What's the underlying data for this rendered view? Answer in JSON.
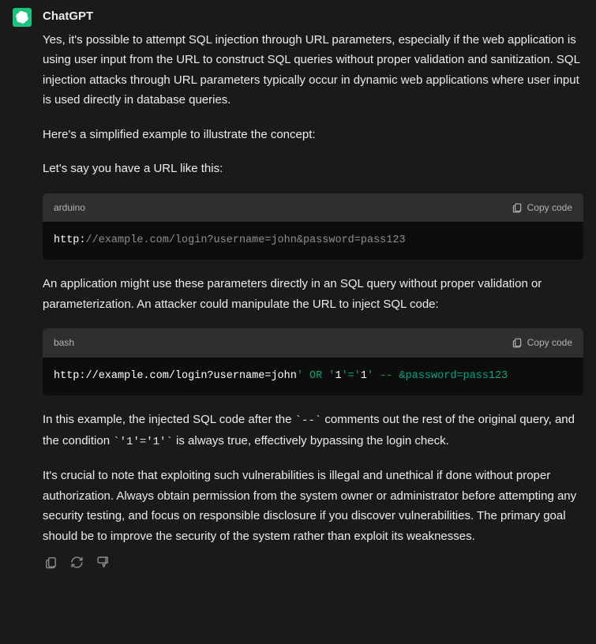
{
  "author": "ChatGPT",
  "paragraphs": {
    "p1": "Yes, it's possible to attempt SQL injection through URL parameters, especially if the web application is using user input from the URL to construct SQL queries without proper validation and sanitization. SQL injection attacks through URL parameters typically occur in dynamic web applications where user input is used directly in database queries.",
    "p2": "Here's a simplified example to illustrate the concept:",
    "p3": "Let's say you have a URL like this:",
    "p4": "An application might use these parameters directly in an SQL query without proper validation or parameterization. An attacker could manipulate the URL to inject SQL code:",
    "p5a": "In this example, the injected SQL code after the ",
    "p5code1": "`--`",
    "p5b": " comments out the rest of the original query, and the condition ",
    "p5code2": "`'1'='1'`",
    "p5c": " is always true, effectively bypassing the login check.",
    "p6": "It's crucial to note that exploiting such vulnerabilities is illegal and unethical if done without proper authorization. Always obtain permission from the system owner or administrator before attempting any security testing, and focus on responsible disclosure if you discover vulnerabilities. The primary goal should be to improve the security of the system rather than exploit its weaknesses."
  },
  "code1": {
    "lang": "arduino",
    "copy": "Copy code",
    "tokens": {
      "a": "http:",
      "b": "//example.com/login?username=john&password=pass123"
    }
  },
  "code2": {
    "lang": "bash",
    "copy": "Copy code",
    "tokens": {
      "a": "http://example.com/login?username=john",
      "b": "' OR '",
      "c": "1",
      "d": "'='",
      "e": "1",
      "f": "'",
      "g": " -- &password=pass123"
    }
  }
}
